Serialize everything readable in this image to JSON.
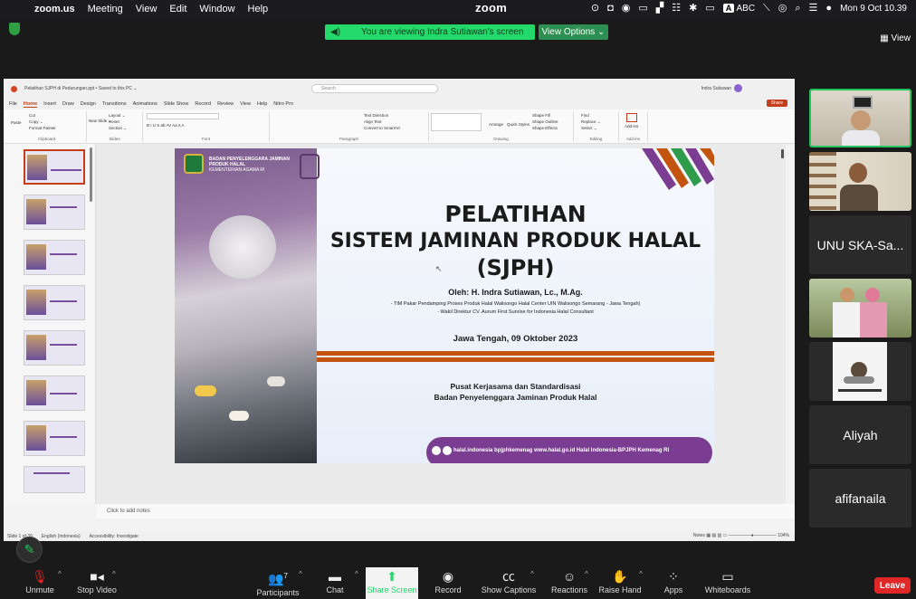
{
  "menubar": {
    "app": "zoom.us",
    "items": [
      "Meeting",
      "View",
      "Edit",
      "Window",
      "Help"
    ],
    "brand": "zoom",
    "input_source": "A",
    "input_label": "ABC",
    "clock": "Mon 9 Oct 10.39"
  },
  "banner": {
    "text": "You are viewing Indra Sutiawan's screen",
    "view_options": "View Options ⌄",
    "view": "View"
  },
  "ppt": {
    "title": "Pelatihan SJPH di Pedurungan.ppt • Saved to this PC ⌄",
    "search": "Search",
    "user": "Indra Sutiawan",
    "tabs": [
      "File",
      "Home",
      "Insert",
      "Draw",
      "Design",
      "Transitions",
      "Animations",
      "Slide Show",
      "Record",
      "Review",
      "View",
      "Help",
      "Nitro Pro"
    ],
    "active_tab": "Home",
    "share": "Share",
    "groups": [
      {
        "label": "Clipboard",
        "items": [
          "Paste",
          "Cut",
          "Copy ⌄",
          "Format Painter"
        ]
      },
      {
        "label": "Slides",
        "items": [
          "New Slide ⌄",
          "Layout ⌄",
          "Reset",
          "Section ⌄"
        ]
      },
      {
        "label": "Font",
        "items": [
          "B I U S ab AV Aa A A"
        ]
      },
      {
        "label": "Paragraph",
        "items": [
          "Text Direction",
          "Align Text",
          "Convert to SmartArt"
        ]
      },
      {
        "label": "Drawing",
        "items": [
          "Arrange",
          "Quick Styles",
          "Shape Fill",
          "Shape Outline",
          "Shape Effects"
        ]
      },
      {
        "label": "Editing",
        "items": [
          "Find",
          "Replace ⌄",
          "Select ⌄"
        ]
      },
      {
        "label": "Add-ins",
        "items": [
          "Add-ins"
        ]
      }
    ],
    "slide_numbers": [
      "1",
      "2",
      "3",
      "4",
      "5",
      "6",
      "7",
      "8"
    ],
    "notes": "Click to add notes",
    "status": {
      "slide": "Slide 1 of 39",
      "lang": "English (Indonesia)",
      "access": "Accessibility: Investigate",
      "notes_btn": "Notes",
      "zoom": "104%"
    }
  },
  "slide": {
    "agency": "BADAN PENYELENGGARA JAMINAN PRODUK HALAL",
    "ministry": "KEMENTERIAN AGAMA RI",
    "title1": "PELATIHAN",
    "title2": "SISTEM JAMINAN PRODUK HALAL",
    "title3": "(SJPH)",
    "presenter": "Oleh: H. Indra Sutiawan, Lc., M.Ag.",
    "role1": "- TIM Pakar Pendamping Proses Produk Halal Walisongo Halal Center UIN Walisongo Semarang - Jawa Tengah)",
    "role2": "- Wakil Direktur CV. Aurum First Sunrise for Indonesia Halal Consultant",
    "date": "Jawa Tengah, 09 Oktober 2023",
    "center1": "Pusat Kerjasama dan Standardisasi",
    "center2": "Badan Penyelenggara Jaminan Produk Halal",
    "footer": "halal.indonesia   bpjphkemenag   www.halal.go.id   Halal Indonesia-BPJPH Kemenag RI"
  },
  "tiles": [
    {
      "name": ""
    },
    {
      "name": ""
    },
    {
      "name": "UNU SKA-Sa..."
    },
    {
      "name": ""
    },
    {
      "name": ""
    },
    {
      "name": "Aliyah"
    },
    {
      "name": "afifanaila"
    }
  ],
  "toolbar": {
    "unmute": "Unmute",
    "stop_video": "Stop Video",
    "participants": "Participants",
    "participants_count": "7",
    "chat": "Chat",
    "share": "Share Screen",
    "record": "Record",
    "captions": "Show Captions",
    "reactions": "Reactions",
    "raise_hand": "Raise Hand",
    "apps": "Apps",
    "whiteboards": "Whiteboards",
    "leave": "Leave"
  },
  "colors": {
    "green": "#23d96b",
    "leave": "#e02828",
    "accent": "#c43e1c",
    "purple": "#7a3d91"
  }
}
